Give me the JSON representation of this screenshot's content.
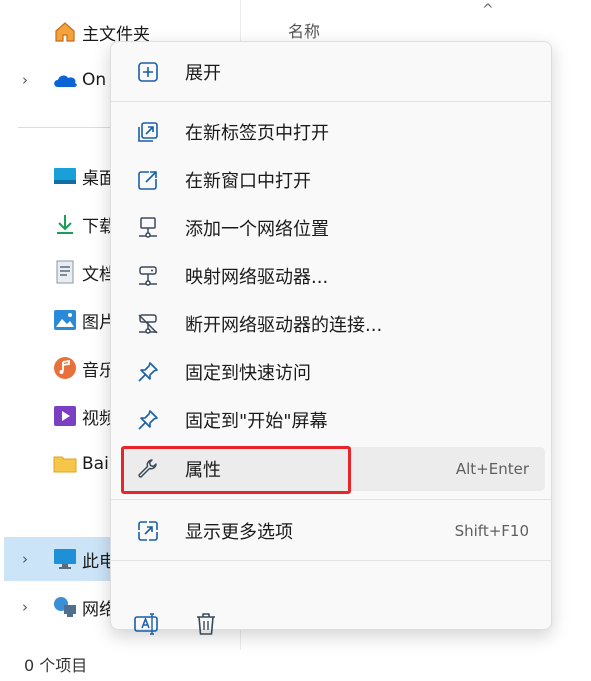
{
  "nav": {
    "items": [
      {
        "label": "主文件夹",
        "icon": "home-icon"
      },
      {
        "label": "On",
        "icon": "onedrive-cloud-icon",
        "chevron": "›"
      },
      {
        "label": "桌面",
        "icon": "desktop-folder-icon"
      },
      {
        "label": "下载",
        "icon": "download-arrow-icon"
      },
      {
        "label": "文档",
        "icon": "document-icon"
      },
      {
        "label": "图片",
        "icon": "pictures-icon"
      },
      {
        "label": "音乐",
        "icon": "music-icon"
      },
      {
        "label": "视频",
        "icon": "videos-icon"
      },
      {
        "label": "Bai",
        "icon": "folder-icon"
      },
      {
        "label": "此电",
        "icon": "this-pc-icon",
        "chevron": "›"
      },
      {
        "label": "网络",
        "icon": "network-icon",
        "chevron": "›"
      }
    ]
  },
  "file_list": {
    "column_header": "名称",
    "sort_arrow": "^"
  },
  "status_bar": {
    "text": "0 个项目"
  },
  "context_menu": {
    "items": [
      {
        "label": "展开",
        "icon": "expand-plus-icon",
        "shortcut": ""
      },
      {
        "label": "在新标签页中打开",
        "icon": "open-new-tab-icon",
        "shortcut": ""
      },
      {
        "label": "在新窗口中打开",
        "icon": "open-new-window-icon",
        "shortcut": ""
      },
      {
        "label": "添加一个网络位置",
        "icon": "add-network-location-icon",
        "shortcut": ""
      },
      {
        "label": "映射网络驱动器...",
        "icon": "map-network-drive-icon",
        "shortcut": ""
      },
      {
        "label": "断开网络驱动器的连接...",
        "icon": "disconnect-network-drive-icon",
        "shortcut": ""
      },
      {
        "label": "固定到快速访问",
        "icon": "pin-icon",
        "shortcut": ""
      },
      {
        "label": "固定到\"开始\"屏幕",
        "icon": "pin-icon",
        "shortcut": ""
      },
      {
        "label": "属性",
        "icon": "wrench-icon",
        "shortcut": "Alt+Enter"
      },
      {
        "label": "显示更多选项",
        "icon": "show-more-options-icon",
        "shortcut": "Shift+F10"
      }
    ],
    "bottom_icons": [
      "rename-icon",
      "delete-trash-icon"
    ],
    "highlight_color": "#e8262a",
    "accent_color": "#0067c0"
  }
}
